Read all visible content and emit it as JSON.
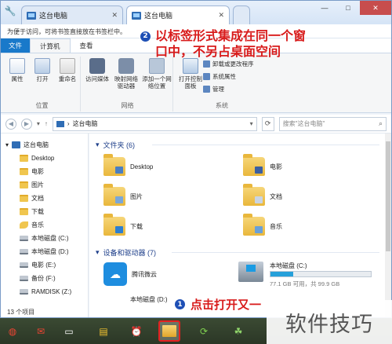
{
  "window": {
    "tabs": [
      {
        "label": "这台电脑",
        "active": false
      },
      {
        "label": "这台电脑",
        "active": true
      }
    ],
    "new_tab_label": "",
    "controls": {
      "minimize": "—",
      "maximize": "□",
      "close": "✕"
    }
  },
  "favorites_bar": {
    "text": "为便于访问，可将书签直接放在书签栏中。"
  },
  "ribbon": {
    "tabs": [
      {
        "label": "文件",
        "kind": "file"
      },
      {
        "label": "计算机",
        "kind": "active"
      },
      {
        "label": "查看",
        "kind": "normal"
      }
    ],
    "groups": [
      {
        "name": "位置",
        "buttons": [
          {
            "label": "属性",
            "icon": "properties-icon"
          },
          {
            "label": "打开",
            "icon": "open-icon"
          },
          {
            "label": "重命名",
            "icon": "rename-icon"
          }
        ]
      },
      {
        "name": "网络",
        "buttons": [
          {
            "label": "访问媒体",
            "icon": "media-icon"
          },
          {
            "label": "映射网络驱动器",
            "icon": "map-drive-icon"
          },
          {
            "label": "添加一个网络位置",
            "icon": "add-network-icon"
          }
        ]
      },
      {
        "name": "系统",
        "buttons": [
          {
            "label": "打开控制面板",
            "icon": "control-panel-icon"
          }
        ],
        "small_items": [
          "卸载或更改程序",
          "系统属性",
          "管理"
        ]
      }
    ]
  },
  "annotations": {
    "step2_number": "2",
    "step2_line1": "以标签形式集成在同一个窗",
    "step2_line2": "口中，不另占桌面空间",
    "step1_number": "1",
    "step1_text": "点击打开又一",
    "watermark": "软件技巧"
  },
  "address_bar": {
    "path": "这台电脑",
    "search_placeholder": "搜索\"这台电脑\""
  },
  "nav_pane": {
    "items": [
      {
        "label": "这台电脑",
        "icon": "pc-icon",
        "level": 0
      },
      {
        "label": "Desktop",
        "icon": "folder-icon",
        "level": 1
      },
      {
        "label": "电影",
        "icon": "folder-icon",
        "level": 1
      },
      {
        "label": "图片",
        "icon": "folder-icon",
        "level": 1
      },
      {
        "label": "文档",
        "icon": "folder-icon",
        "level": 1
      },
      {
        "label": "下载",
        "icon": "folder-icon",
        "level": 1
      },
      {
        "label": "音乐",
        "icon": "music-icon",
        "level": 1
      },
      {
        "label": "本地磁盘 (C:)",
        "icon": "drive-icon",
        "level": 1
      },
      {
        "label": "本地磁盘 (D:)",
        "icon": "drive-icon",
        "level": 1
      },
      {
        "label": "电影 (E:)",
        "icon": "drive-icon",
        "level": 1
      },
      {
        "label": "备份 (F:)",
        "icon": "drive-icon",
        "level": 1
      },
      {
        "label": "RAMDISK (Z:)",
        "icon": "drive-icon",
        "level": 1
      }
    ],
    "status": "13 个项目"
  },
  "content": {
    "folders_header": "文件夹 (6)",
    "folders": [
      {
        "label": "Desktop",
        "badge_color": "#4a7fc1"
      },
      {
        "label": "电影",
        "badge_color": "#3b5fa0"
      },
      {
        "label": "图片",
        "badge_color": "#7aa7d8"
      },
      {
        "label": "文档",
        "badge_color": "#c9d4e2"
      },
      {
        "label": "下载",
        "badge_color": "#2d7fd0"
      },
      {
        "label": "音乐",
        "badge_color": "#6aa0d8"
      }
    ],
    "devices_header": "设备和驱动器 (7)",
    "devices": [
      {
        "label": "腾讯微云",
        "icon": "cloud-icon"
      }
    ],
    "drive_c": {
      "label": "本地磁盘 (C:)",
      "size_text": "77.1 GB 可用，共 99.9 GB",
      "used_fraction": 0.23
    },
    "drive_d_label": "本地磁盘 (D:)"
  },
  "taskbar": {
    "items": [
      {
        "name": "app-red-icon",
        "glyph": "◍",
        "active": false
      },
      {
        "name": "app-card-icon",
        "glyph": "✉",
        "active": false
      },
      {
        "name": "monitor-icon",
        "glyph": "▭",
        "active": false
      },
      {
        "name": "notes-icon",
        "glyph": "▤",
        "active": false
      },
      {
        "name": "alarm-icon",
        "glyph": "⏰",
        "active": false
      },
      {
        "name": "file-explorer-icon",
        "glyph": "",
        "active": true
      },
      {
        "name": "refresh-app-icon",
        "glyph": "⟳",
        "active": false
      },
      {
        "name": "clover-icon",
        "glyph": "☘",
        "active": false
      }
    ]
  }
}
